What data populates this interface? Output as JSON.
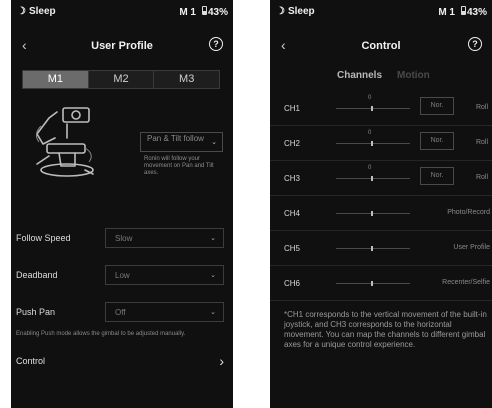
{
  "status_bar": {
    "sleep_label": "Sleep",
    "profile": "M 1",
    "battery": "43%"
  },
  "left_screen": {
    "title": "User Profile",
    "help": "?",
    "profiles": [
      "M1",
      "M2",
      "M3"
    ],
    "selected_profile": "M1",
    "follow_mode": {
      "value": "Pan & Tilt follow",
      "description": "Ronin will follow your movement on Pan and Tilt axes."
    },
    "settings": [
      {
        "label": "Follow Speed",
        "value": "Slow"
      },
      {
        "label": "Deadband",
        "value": "Low"
      },
      {
        "label": "Push Pan",
        "value": "Off"
      }
    ],
    "push_note": "Enabling Push mode allows the gimbal to be adjusted manually.",
    "control_label": "Control"
  },
  "right_screen": {
    "title": "Control",
    "tabs": [
      "Channels",
      "Motion"
    ],
    "channels": [
      {
        "name": "CH1",
        "zero": "0",
        "mode": "Nor.",
        "function": "Roll"
      },
      {
        "name": "CH2",
        "zero": "0",
        "mode": "Nor.",
        "function": "Roll"
      },
      {
        "name": "CH3",
        "zero": "0",
        "mode": "Nor.",
        "function": "Roll"
      },
      {
        "name": "CH4",
        "function": "Photo/Record"
      },
      {
        "name": "CH5",
        "function": "User Profile"
      },
      {
        "name": "CH6",
        "function": "Recenter/Selfie"
      }
    ],
    "footnote": "*CH1 corresponds to the vertical movement of the built-in joystick, and CH3 corresponds to the horizontal movement. You can map the channels to different gimbal axes for a unique control experience."
  },
  "colors": {
    "background": "#101010",
    "segment_active": "#6b6b6b",
    "text_primary": "#e8e8e8",
    "text_muted": "#8a8a8a"
  }
}
